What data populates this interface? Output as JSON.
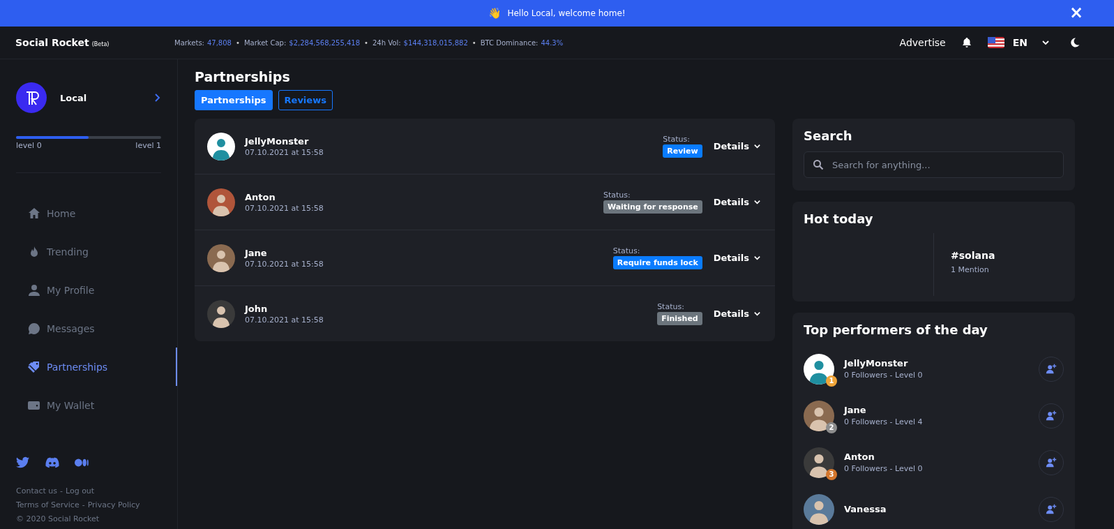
{
  "banner": {
    "emoji": "👋",
    "text": "Hello Local, welcome home!",
    "close": "×"
  },
  "header": {
    "brand": "Social Rocket",
    "brand_tag": "(Beta)",
    "stats": [
      {
        "label": "Markets:",
        "value": "47,808"
      },
      {
        "label": "Market Cap:",
        "value": "$2,284,568,255,418"
      },
      {
        "label": "24h Vol:",
        "value": "$144,318,015,882"
      },
      {
        "label": "BTC Dominance:",
        "value": "44.3%"
      }
    ],
    "separator": "•",
    "advertise": "Advertise",
    "language": "EN"
  },
  "sidebar": {
    "user": {
      "name": "Local",
      "level": 0.5,
      "level_from": "level 0",
      "level_to": "level 1"
    },
    "items": [
      {
        "label": "Home",
        "selected": false
      },
      {
        "label": "Trending",
        "selected": false
      },
      {
        "label": "My Profile",
        "selected": false
      },
      {
        "label": "Messages",
        "selected": false
      },
      {
        "label": "Partnerships",
        "selected": true
      },
      {
        "label": "My Wallet",
        "selected": false
      }
    ],
    "footer_links": [
      [
        "Contact us",
        "Log out"
      ],
      [
        "Terms of Service",
        "Privacy Policy"
      ]
    ],
    "link_separator": "-",
    "copyright": "© 2020 Social Rocket"
  },
  "page_title": "Partnerships",
  "tabs": [
    {
      "label": "Partnerships",
      "selected": true
    },
    {
      "label": "Reviews",
      "selected": false
    }
  ],
  "partnerships": [
    {
      "name": "JellyMonster",
      "date": "07.10.2021 at 15:58",
      "status_label": "Status:",
      "status": "Review",
      "color": "#0a7cff",
      "details": "Details"
    },
    {
      "name": "Anton",
      "date": "07.10.2021 at 15:58",
      "status_label": "Status:",
      "status": "Waiting for response",
      "color": "#6c757d",
      "details": "Details"
    },
    {
      "name": "Jane",
      "date": "07.10.2021 at 15:58",
      "status_label": "Status:",
      "status": "Require funds lock",
      "color": "#0a7cff",
      "details": "Details"
    },
    {
      "name": "John",
      "date": "07.10.2021 at 15:58",
      "status_label": "Status:",
      "status": "Finished",
      "color": "#6c757d",
      "details": "Details"
    }
  ],
  "search": {
    "title": "Search",
    "placeholder": "Search for anything..."
  },
  "hot_today": {
    "title": "Hot today",
    "tag": "#solana",
    "mentions": "1 Mention"
  },
  "top_performers": {
    "title": "Top performers of the day",
    "items": [
      {
        "name": "JellyMonster",
        "meta": "0 Followers - Level 0",
        "rank": "1",
        "color": "#f0a53a"
      },
      {
        "name": "Jane",
        "meta": "0 Followers - Level 4",
        "rank": "2",
        "color": "#8d8d8d"
      },
      {
        "name": "Anton",
        "meta": "0 Followers - Level 0",
        "rank": "3",
        "color": "#d4762c"
      },
      {
        "name": "Vanessa"
      }
    ]
  }
}
